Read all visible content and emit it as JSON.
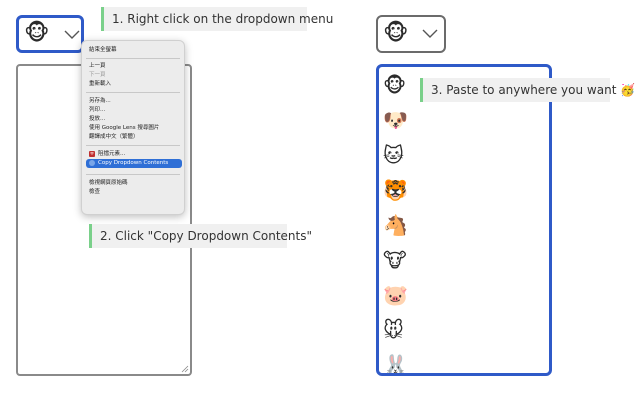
{
  "left_select": {
    "selected_emoji": "🐵"
  },
  "right_select": {
    "selected_emoji": "🐵"
  },
  "callouts": {
    "step1": "1. Right click on the dropdown menu",
    "step2": "2. Click \"Copy Dropdown Contents\"",
    "step3": "3. Paste to anywhere you want 🥳"
  },
  "context_menu": {
    "items": [
      "結束全螢幕",
      "上一頁",
      "下一頁",
      "重新載入",
      "另存為...",
      "列印...",
      "投放...",
      "使用 Google Lens 搜尋圖片",
      "翻譯成中文（繁體）",
      "阻擋元素...",
      "Copy Dropdown Contents",
      "檢視網頁原始碼",
      "檢查"
    ]
  },
  "listbox": {
    "options": [
      "🐵",
      "🐶",
      "🐱",
      "🐯",
      "🐴",
      "🐮",
      "🐷",
      "🐭",
      "🐰"
    ]
  },
  "colors": {
    "accent": "#2f5ac8",
    "callout_bar": "#7ad08a",
    "menu_highlight": "#2f6fd6"
  }
}
